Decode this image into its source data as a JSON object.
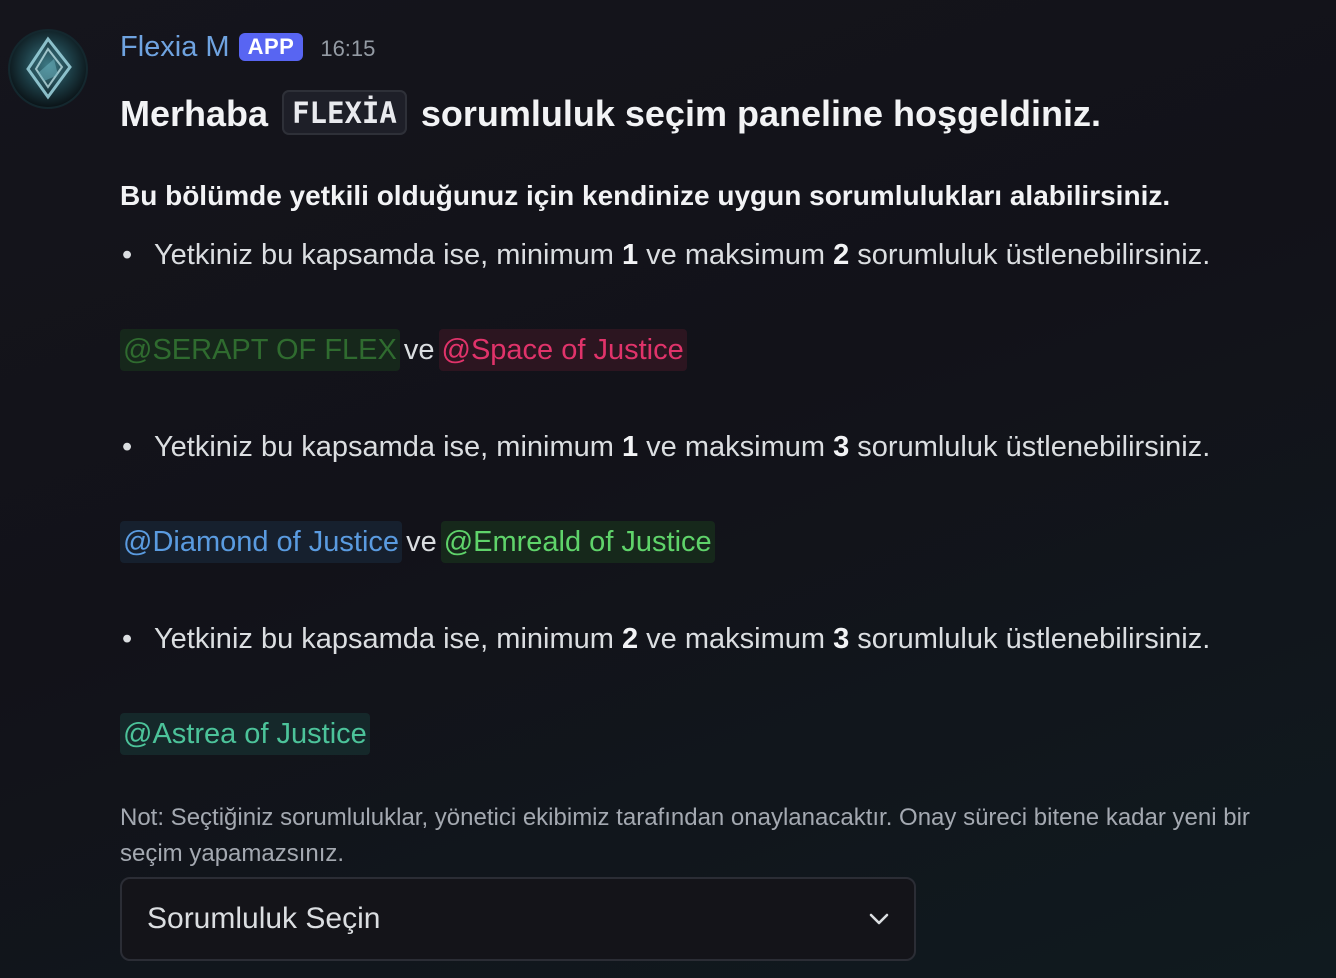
{
  "author": {
    "name": "Flexia M",
    "badge": "APP",
    "timestamp": "16:15",
    "avatar_icon": "flexia-logo-icon"
  },
  "message": {
    "title_prefix": "Merhaba",
    "title_code": "FLEXİA",
    "title_suffix": "sorumluluk seçim paneline hoşgeldiniz.",
    "subtitle": "Bu bölümde yetkili olduğunuz için kendinize uygun sorumlulukları alabilirsiniz.",
    "tiers": [
      {
        "text_a": "Yetkiniz bu kapsamda ise, minimum ",
        "min": "1",
        "text_b": " ve maksimum ",
        "max": "2",
        "text_c": " sorumluluk üstlenebilirsiniz.",
        "connector": "ve",
        "roles": [
          {
            "label": "@SERAPT OF FLEX",
            "color": "#2f6b2f",
            "bg": "#16271b"
          },
          {
            "label": "@Space of Justice",
            "color": "#e0336a",
            "bg": "#2c1520"
          }
        ]
      },
      {
        "text_a": "Yetkiniz bu kapsamda ise, minimum ",
        "min": "1",
        "text_b": " ve maksimum ",
        "max": "3",
        "text_c": " sorumluluk üstlenebilirsiniz.",
        "connector": "ve",
        "roles": [
          {
            "label": "@Diamond of Justice",
            "color": "#5a9be0",
            "bg": "#16202e"
          },
          {
            "label": "@Emreald of Justice",
            "color": "#5fd36a",
            "bg": "#16281b"
          }
        ]
      },
      {
        "text_a": "Yetkiniz bu kapsamda ise, minimum ",
        "min": "2",
        "text_b": " ve maksimum ",
        "max": "3",
        "text_c": " sorumluluk üstlenebilirsiniz.",
        "roles": [
          {
            "label": "@Astrea of Justice",
            "color": "#4cc39a",
            "bg": "#15282a"
          }
        ]
      }
    ],
    "note": "Not: Seçtiğiniz sorumluluklar, yönetici ekibimiz tarafından onaylanacaktır. Onay süreci bitene kadar yeni bir seçim yapamazsınız."
  },
  "select": {
    "placeholder": "Sorumluluk Seçin",
    "icon": "chevron-down-icon"
  }
}
